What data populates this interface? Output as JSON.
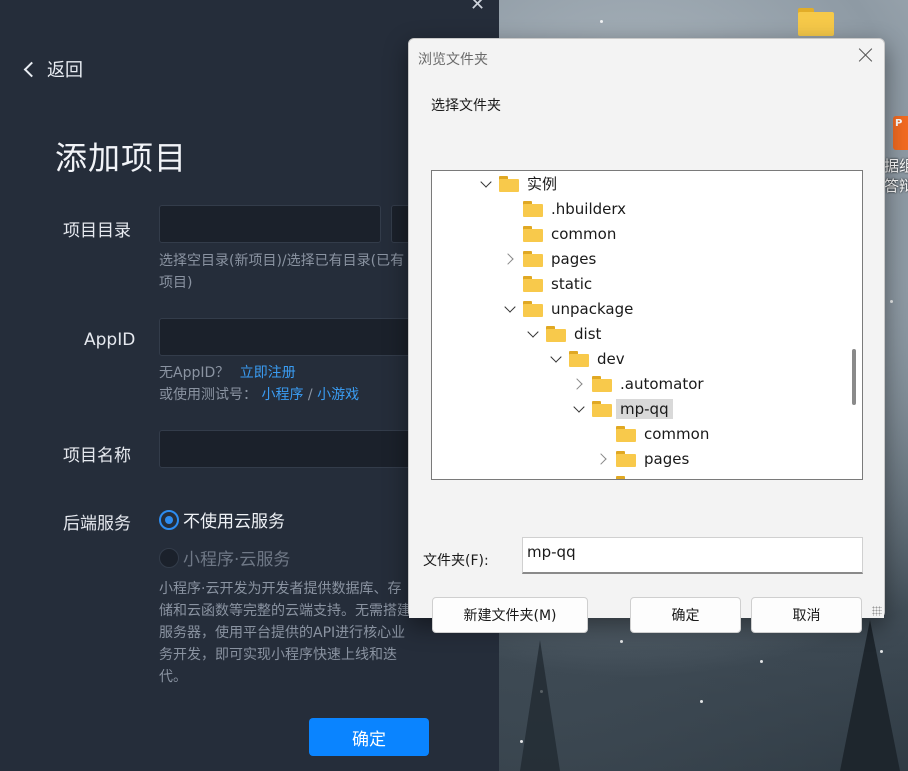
{
  "app": {
    "back_label": "返回",
    "title": "添加项目",
    "project_dir_label": "项目目录",
    "project_dir_hint": "选择空目录(新项目)/选择已有目录(已有",
    "project_dir_hint_cont": "项目)",
    "appid_label": "AppID",
    "no_appid_text": "无AppID？",
    "register_link": "立即注册",
    "test_account_text": "或使用测试号：",
    "mini_program_link": "小程序",
    "separator": "/",
    "mini_game_link": "小游戏",
    "project_name_label": "项目名称",
    "backend_label": "后端服务",
    "option_no_cloud": "不使用云服务",
    "option_cloud": "小程序·云服务",
    "cloud_desc_lines": [
      "小程序·云开发为开发者提供数据库、存",
      "储和云函数等完整的云端支持。无需搭建",
      "服务器，使用平台提供的API进行核心业",
      "务开发，即可实现小程序快速上线和迭",
      "代。"
    ],
    "confirm_label": "确定"
  },
  "dialog": {
    "title": "浏览文件夹",
    "description": "选择文件夹",
    "tree": [
      {
        "name": "实例",
        "chevron": "down"
      },
      {
        "name": ".hbuilderx",
        "chevron": "none"
      },
      {
        "name": "common",
        "chevron": "none"
      },
      {
        "name": "pages",
        "chevron": "right"
      },
      {
        "name": "static",
        "chevron": "none"
      },
      {
        "name": "unpackage",
        "chevron": "down"
      },
      {
        "name": "dist",
        "chevron": "down"
      },
      {
        "name": "dev",
        "chevron": "down"
      },
      {
        "name": ".automator",
        "chevron": "right"
      },
      {
        "name": "mp-qq",
        "chevron": "down",
        "selected": true
      },
      {
        "name": "common",
        "chevron": "none"
      },
      {
        "name": "pages",
        "chevron": "right"
      }
    ],
    "folder_label": "文件夹(F):",
    "folder_value": "mp-qq",
    "new_folder_button": "新建文件夹(M)",
    "ok_button": "确定",
    "cancel_button": "取消"
  },
  "desktop": {
    "right_label": "据组\n答辩"
  },
  "colors": {
    "accent": "#0a84ff",
    "link": "#3a9cf2",
    "panel_bg": "#252d3a",
    "folder_yellow": "#f8c94b"
  }
}
